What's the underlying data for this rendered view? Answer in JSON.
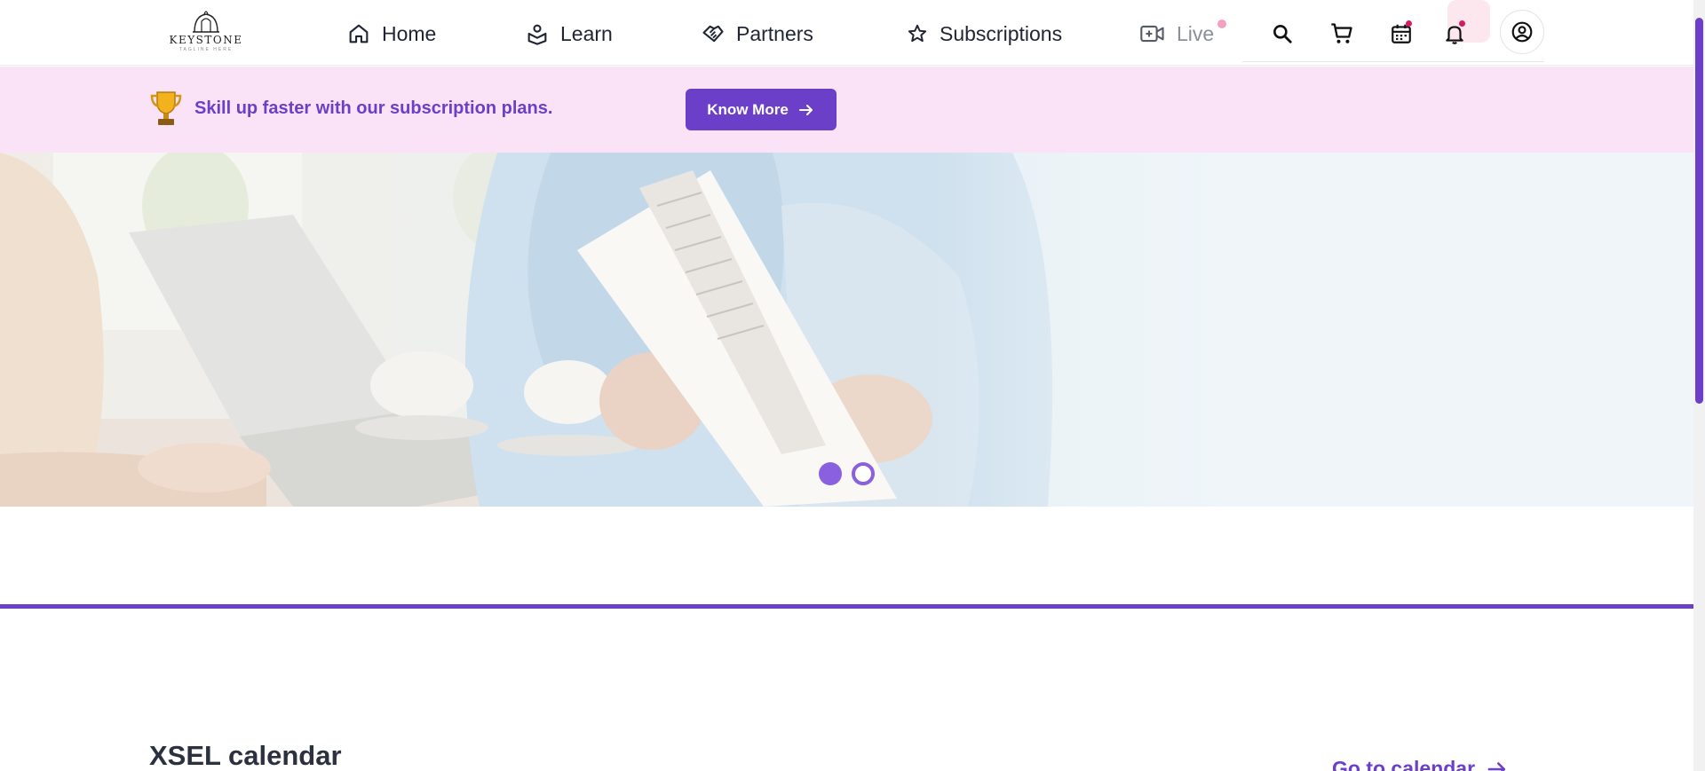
{
  "header": {
    "logo": {
      "name": "KEYSTONE",
      "tagline": "TAGLINE HERE"
    },
    "nav": {
      "home": "Home",
      "learn": "Learn",
      "partners": "Partners",
      "subscriptions": "Subscriptions",
      "live": "Live"
    },
    "icons": [
      "search-icon",
      "cart-icon",
      "calendar-icon",
      "bell-icon",
      "user-icon"
    ]
  },
  "promo": {
    "text": "Skill up faster with our subscription plans.",
    "button": "Know More"
  },
  "hero": {
    "slides": 2,
    "active_slide": 1
  },
  "calendar": {
    "title": "XSEL calendar",
    "link": "Go to calendar"
  },
  "colors": {
    "accent": "#6c3fc9",
    "promo_bg": "#fbe3f7",
    "notification": "#d81b60"
  }
}
